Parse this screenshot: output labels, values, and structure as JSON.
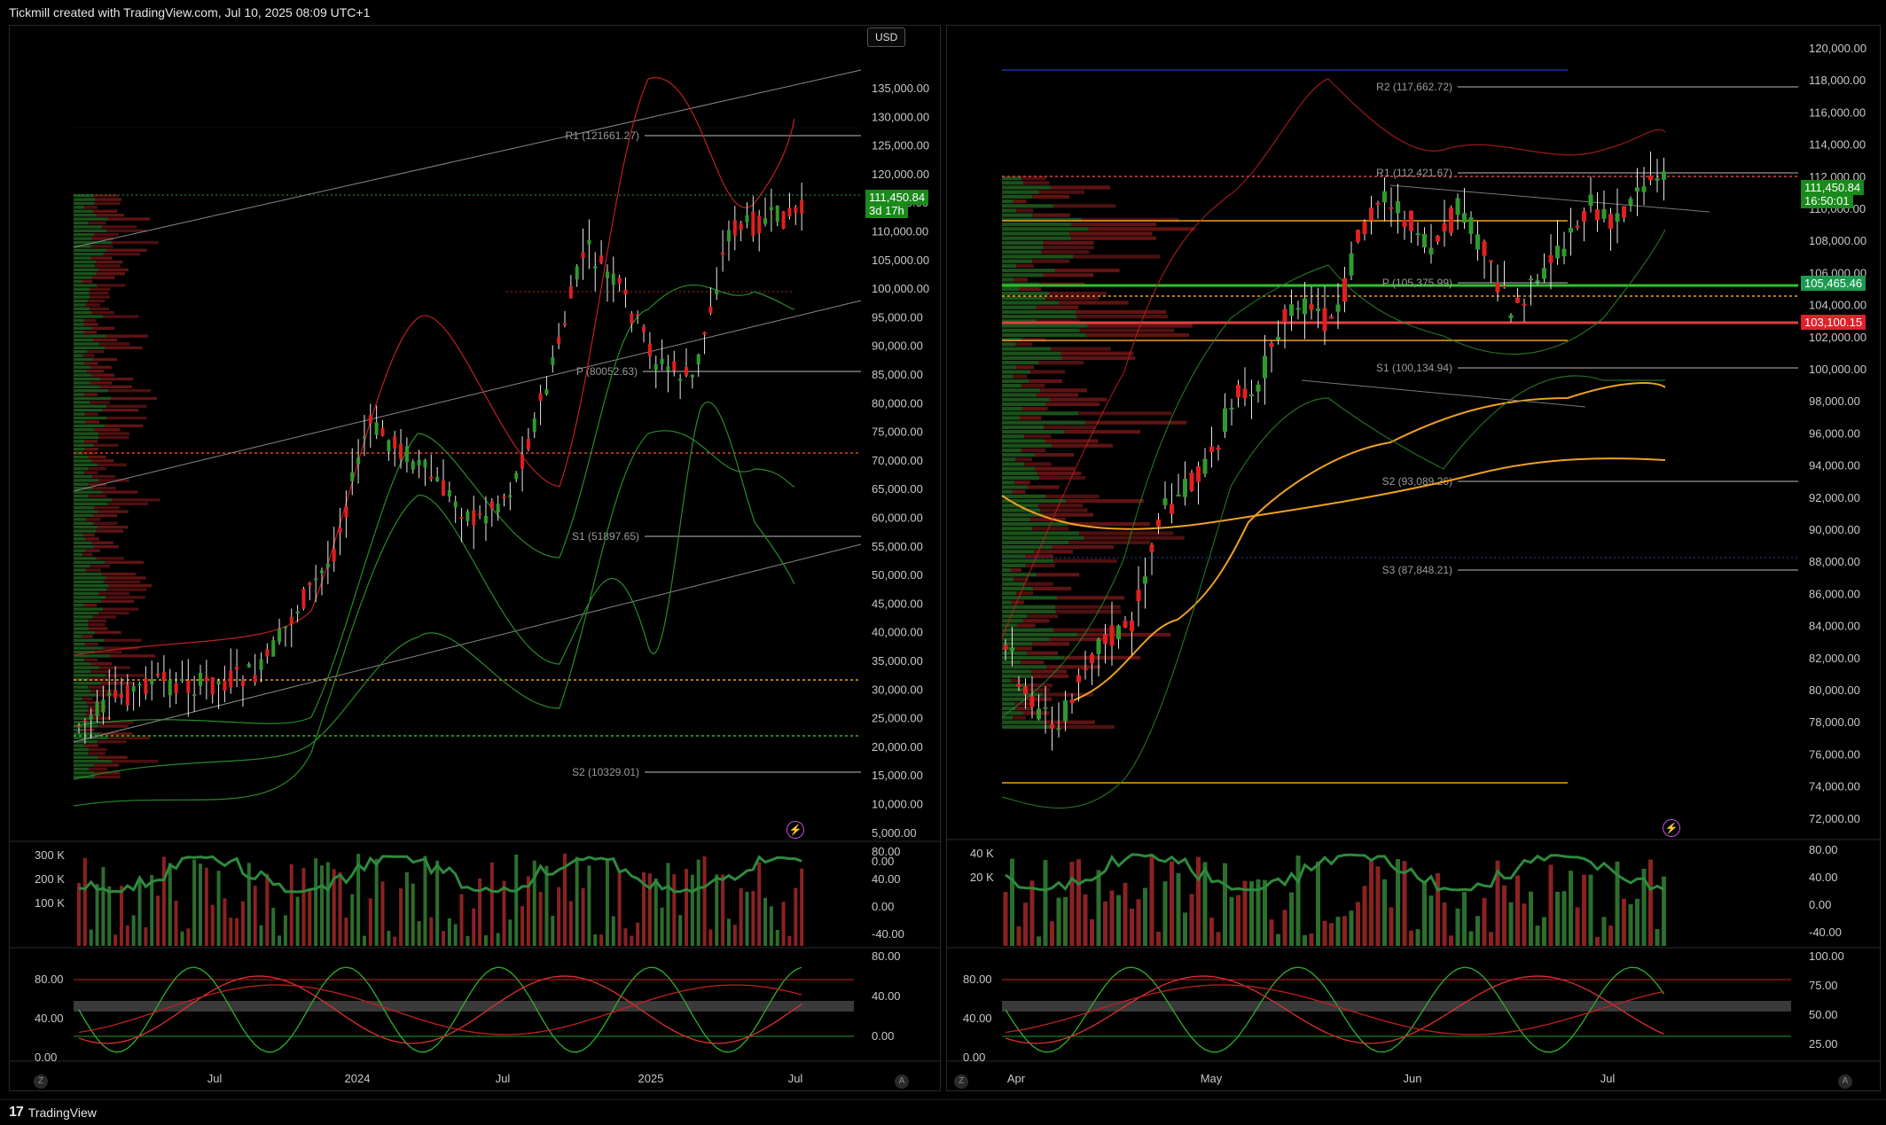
{
  "header": {
    "credit": "Tickmill created with TradingView.com, Jul 10, 2025 08:09 UTC+1"
  },
  "footer": {
    "brand": "TradingView",
    "logo": "17"
  },
  "left_chart": {
    "currency_button": "USD",
    "y_axis": [
      "135,000.00",
      "130,000.00",
      "125,000.00",
      "120,000.00",
      "115,000.00",
      "110,000.00",
      "105,000.00",
      "100,000.00",
      "95,000.00",
      "90,000.00",
      "85,000.00",
      "80,000.00",
      "75,000.00",
      "70,000.00",
      "65,000.00",
      "60,000.00",
      "55,000.00",
      "50,000.00",
      "45,000.00",
      "40,000.00",
      "35,000.00",
      "30,000.00",
      "25,000.00",
      "20,000.00",
      "15,000.00",
      "10,000.00",
      "5,000.00",
      "0.00"
    ],
    "pivots": {
      "r1": "R1 (121661.27)",
      "p": "P (80052.63)",
      "s1": "S1 (51897.65)",
      "s2": "S2 (10329.01)"
    },
    "last_price": "111,450.84",
    "countdown": "3d 17h",
    "x_axis": [
      "Jul",
      "2024",
      "Jul",
      "2025",
      "Jul"
    ],
    "volume_axis": [
      "300 K",
      "200 K",
      "100 K"
    ],
    "rsi_axis": [
      "80.00",
      "40.00",
      "0.00",
      "-40.00"
    ],
    "stoch_axis_left": [
      "80.00",
      "40.00",
      "0.00"
    ],
    "stoch_axis_right": [
      "80.00",
      "40.00",
      "0.00"
    ],
    "corner_left": "Z",
    "corner_right": "A"
  },
  "right_chart": {
    "y_axis": [
      "120,000.00",
      "118,000.00",
      "116,000.00",
      "114,000.00",
      "112,000.00",
      "110,000.00",
      "108,000.00",
      "106,000.00",
      "104,000.00",
      "102,000.00",
      "100,000.00",
      "98,000.00",
      "96,000.00",
      "94,000.00",
      "92,000.00",
      "90,000.00",
      "88,000.00",
      "86,000.00",
      "84,000.00",
      "82,000.00",
      "80,000.00",
      "78,000.00",
      "76,000.00",
      "74,000.00",
      "72,000.00"
    ],
    "pivots": {
      "r2": "R2 (117,662.72)",
      "r1": "R1 (112,421.67)",
      "p": "P (105,375.99)",
      "s1": "S1 (100,134.94)",
      "s2": "S2 (93,089.26)",
      "s3": "S3 (87,848.21)"
    },
    "last_price": "111,450.84",
    "countdown": "16:50:01",
    "green_level": "105,465.46",
    "red_level": "103,100.15",
    "x_axis": [
      "Apr",
      "May",
      "Jun",
      "Jul"
    ],
    "volume_axis": [
      "40 K",
      "20 K"
    ],
    "rsi_axis": [
      "80.00",
      "40.00",
      "0.00",
      "-40.00"
    ],
    "stoch_axis_left": [
      "80.00",
      "40.00",
      "0.00"
    ],
    "stoch_axis_right": [
      "100.00",
      "75.00",
      "50.00",
      "25.00"
    ],
    "corner_left": "Z",
    "corner_right": "A"
  },
  "colors": {
    "up": "#2e8b2e",
    "down": "#e02020",
    "price_tag": "#1a8a1a",
    "red_tag": "#e0202a",
    "ma_orange": "#f0a020"
  }
}
